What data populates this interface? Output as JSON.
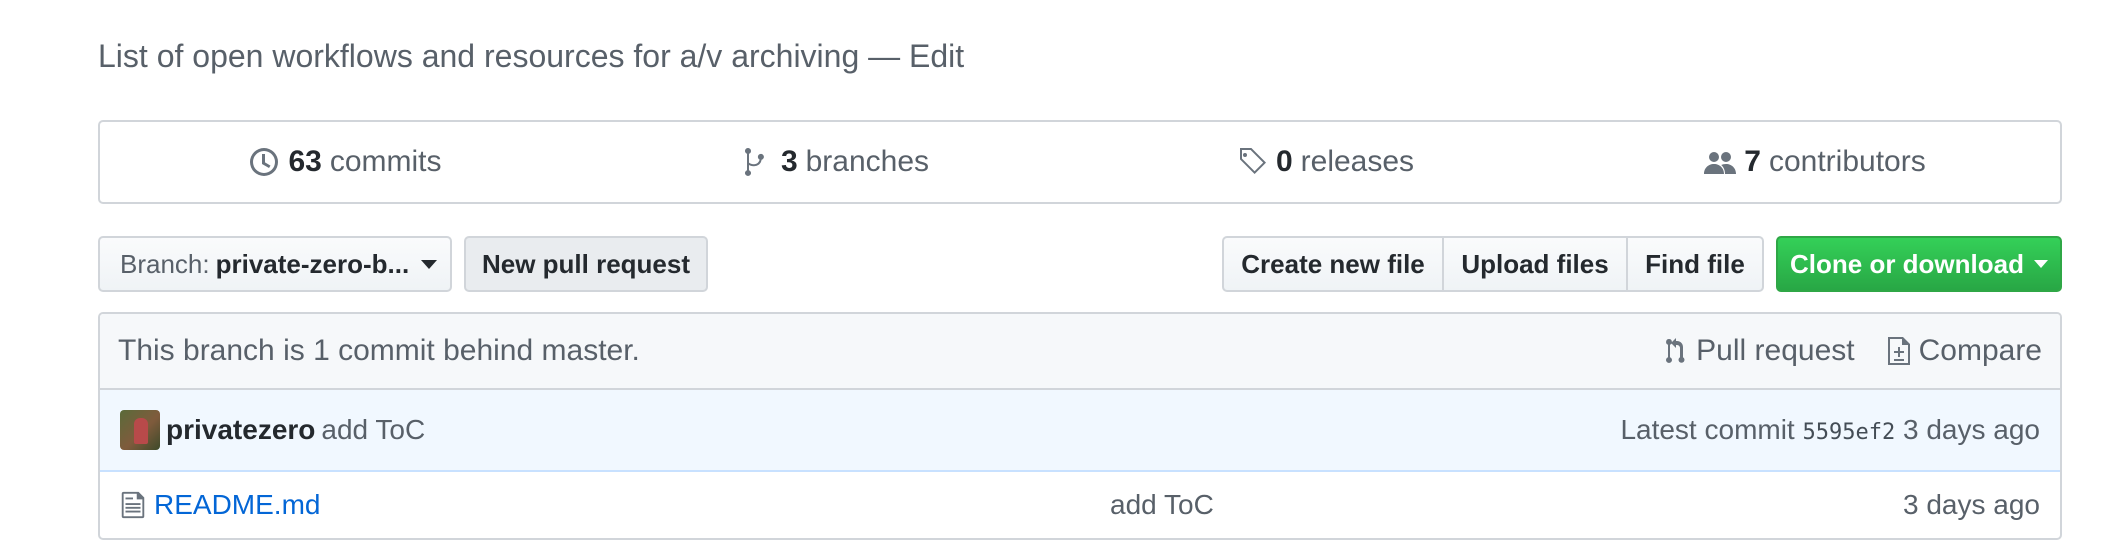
{
  "repo": {
    "description": "List of open workflows and resources for a/v archiving",
    "edit_label": "Edit"
  },
  "stats": {
    "commits": {
      "count": "63",
      "label": "commits",
      "icon": "history-icon"
    },
    "branches": {
      "count": "3",
      "label": "branches",
      "icon": "git-branch-icon"
    },
    "releases": {
      "count": "0",
      "label": "releases",
      "icon": "tag-icon"
    },
    "contributors": {
      "count": "7",
      "label": "contributors",
      "icon": "people-icon"
    }
  },
  "toolbar": {
    "branch_prefix": "Branch:",
    "branch_name": "private-zero-b...",
    "new_pr_label": "New pull request",
    "create_file_label": "Create new file",
    "upload_files_label": "Upload files",
    "find_file_label": "Find file",
    "clone_label": "Clone or download",
    "clone_color": "#28a745"
  },
  "branch_info": {
    "status": "This branch is 1 commit behind master.",
    "pull_request_label": "Pull request",
    "compare_label": "Compare"
  },
  "latest_commit": {
    "author": "privatezero",
    "message": "add ToC",
    "prefix": "Latest commit",
    "sha": "5595ef2",
    "age": "3 days ago"
  },
  "files": [
    {
      "name": "README.md",
      "message": "add ToC",
      "age": "3 days ago",
      "icon": "file-icon"
    }
  ]
}
